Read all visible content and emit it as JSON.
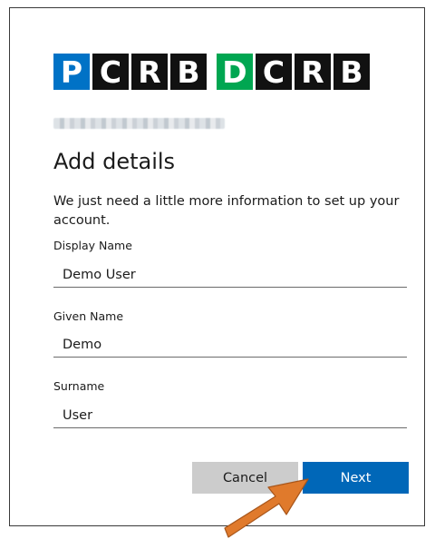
{
  "brand": {
    "logo_left": [
      "P",
      "C",
      "R",
      "B"
    ],
    "logo_right": [
      "D",
      "C",
      "R",
      "B"
    ],
    "accent_left": "#0072c6",
    "accent_right": "#00a651",
    "tile_color": "#111111"
  },
  "form": {
    "heading": "Add details",
    "intro": "We just need a little more information to set up your account.",
    "fields": [
      {
        "label": "Display Name",
        "value": "Demo User"
      },
      {
        "label": "Given Name",
        "value": "Demo"
      },
      {
        "label": "Surname",
        "value": "User"
      }
    ]
  },
  "actions": {
    "cancel_label": "Cancel",
    "next_label": "Next",
    "next_color": "#0067b8"
  },
  "annotation": {
    "icon": "arrow-pointer-icon",
    "color": "#e07a2c"
  }
}
